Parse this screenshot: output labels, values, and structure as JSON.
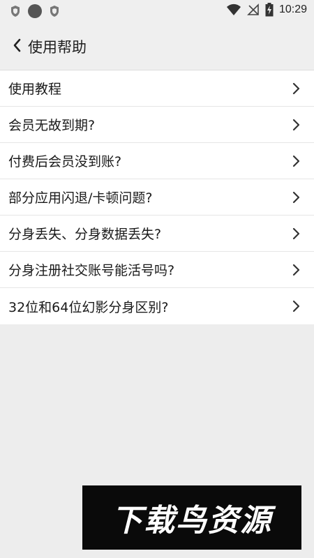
{
  "status_bar": {
    "time": "10:29",
    "left_icons": [
      "shield-icon",
      "circle-icon",
      "shield-icon"
    ],
    "right_icons": [
      "wifi-icon",
      "no-signal-icon",
      "battery-charging-icon"
    ]
  },
  "header": {
    "back_icon": "chevron-left-icon",
    "title": "使用帮助"
  },
  "help_items": [
    {
      "label": "使用教程"
    },
    {
      "label": "会员无故到期?"
    },
    {
      "label": "付费后会员没到账?"
    },
    {
      "label": "部分应用闪退/卡顿问题?"
    },
    {
      "label": "分身丢失、分身数据丢失?"
    },
    {
      "label": "分身注册社交账号能活号吗?"
    },
    {
      "label": "32位和64位幻影分身区别?"
    }
  ],
  "watermark": {
    "text": "下载鸟资源"
  },
  "colors": {
    "background": "#ededed",
    "list_background": "#ffffff",
    "watermark_background": "#0a0a0a"
  }
}
